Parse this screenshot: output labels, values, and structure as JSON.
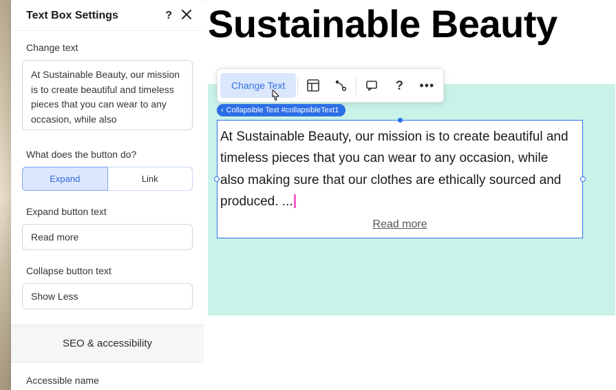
{
  "panel": {
    "title": "Text Box Settings",
    "change_text_label": "Change text",
    "text_value": "At Sustainable Beauty, our mission is to create beautiful and timeless pieces that you can wear to any occasion, while also ",
    "button_question": "What does the button do?",
    "option_expand": "Expand",
    "option_link": "Link",
    "expand_label": "Expand button text",
    "expand_value": "Read more",
    "collapse_label": "Collapse button text",
    "collapse_value": "Show Less",
    "seo_section": "SEO & accessibility",
    "accessible_name_label": "Accessible name"
  },
  "toolbar": {
    "change_text": "Change Text"
  },
  "selection": {
    "tag": "Collapsible Text #collapsibleText1"
  },
  "canvas": {
    "heading": "Sustainable Beauty",
    "paragraph": "At Sustainable Beauty, our mission is to create beautiful and timeless pieces that you can wear to any occasion, while also making sure that our clothes are ethically sourced and produced. ...",
    "read_more": "Read more"
  }
}
